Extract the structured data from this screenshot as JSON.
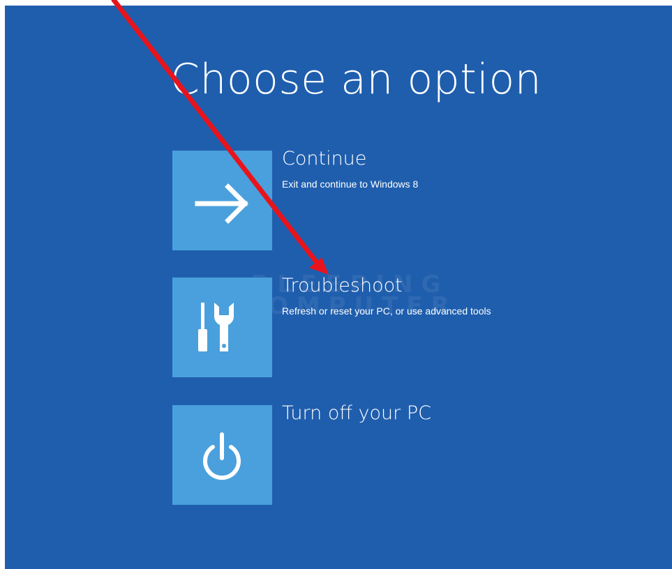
{
  "screen": {
    "title": "Choose an option"
  },
  "options": [
    {
      "title": "Continue",
      "description": "Exit and continue to Windows 8",
      "icon": "arrow-right-icon"
    },
    {
      "title": "Troubleshoot",
      "description": "Refresh or reset your PC, or use advanced tools",
      "icon": "tools-icon"
    },
    {
      "title": "Turn off your PC",
      "description": "",
      "icon": "power-icon"
    }
  ],
  "watermark": {
    "line1": "BLEEPING",
    "line2": "COMPUTER"
  },
  "colors": {
    "background": "#1f5ead",
    "tile": "#4aa0dc",
    "text": "#ffffff",
    "annotation_arrow": "#e8141c"
  }
}
